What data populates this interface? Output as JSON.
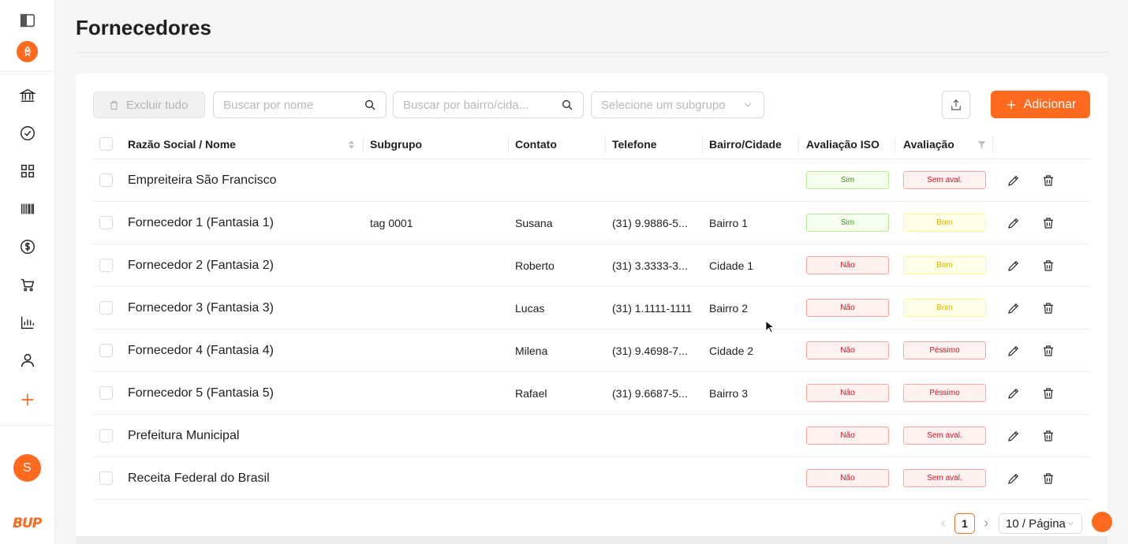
{
  "page": {
    "title": "Fornecedores"
  },
  "sidebar": {
    "items": [
      {
        "icon": "bank-icon"
      },
      {
        "icon": "check-circle-icon"
      },
      {
        "icon": "grid-icon"
      },
      {
        "icon": "barcode-icon"
      },
      {
        "icon": "dollar-icon"
      },
      {
        "icon": "cart-icon"
      },
      {
        "icon": "bar-chart-icon"
      },
      {
        "icon": "user-icon"
      },
      {
        "icon": "plus-icon"
      }
    ],
    "avatar_letter": "S",
    "brand": "BUP"
  },
  "toolbar": {
    "delete_all_label": "Excluir tudo",
    "search_name_placeholder": "Buscar por nome",
    "search_district_placeholder": "Buscar por bairro/cida...",
    "subgroup_placeholder": "Selecione um subgrupo",
    "add_label": "Adicionar"
  },
  "table": {
    "columns": [
      "Razão Social / Nome",
      "Subgrupo",
      "Contato",
      "Telefone",
      "Bairro/Cidade",
      "Avaliação ISO",
      "Avaliação"
    ],
    "rows": [
      {
        "name": "Empreiteira São Francisco",
        "subgroup": "",
        "contact": "",
        "phone": "",
        "district": "",
        "iso": "Sim",
        "rating": "Sem aval."
      },
      {
        "name": "Fornecedor 1 (Fantasia 1)",
        "subgroup": "tag 0001",
        "contact": "Susana",
        "phone": "(31) 9.9886-5...",
        "district": "Bairro 1",
        "iso": "Sim",
        "rating": "Bom"
      },
      {
        "name": "Fornecedor 2 (Fantasia 2)",
        "subgroup": "",
        "contact": "Roberto",
        "phone": "(31) 3.3333-3...",
        "district": "Cidade 1",
        "iso": "Não",
        "rating": "Bom"
      },
      {
        "name": "Fornecedor 3 (Fantasia 3)",
        "subgroup": "",
        "contact": "Lucas",
        "phone": "(31) 1.1111-1111",
        "district": "Bairro 2",
        "iso": "Não",
        "rating": "Bom"
      },
      {
        "name": "Fornecedor 4 (Fantasia 4)",
        "subgroup": "",
        "contact": "Milena",
        "phone": "(31) 9.4698-7...",
        "district": "Cidade 2",
        "iso": "Não",
        "rating": "Péssimo"
      },
      {
        "name": "Fornecedor 5 (Fantasia 5)",
        "subgroup": "",
        "contact": "Rafael",
        "phone": "(31) 9.6687-5...",
        "district": "Bairro 3",
        "iso": "Não",
        "rating": "Péssimo"
      },
      {
        "name": "Prefeitura Municipal",
        "subgroup": "",
        "contact": "",
        "phone": "",
        "district": "",
        "iso": "Não",
        "rating": "Sem aval."
      },
      {
        "name": "Receita Federal do Brasil",
        "subgroup": "",
        "contact": "",
        "phone": "",
        "district": "",
        "iso": "Não",
        "rating": "Sem aval."
      }
    ]
  },
  "pagination": {
    "current_page": "1",
    "page_size": "10 / Página"
  },
  "colors": {
    "accent": "#ff6a1f",
    "tag_green_bg": "#f6ffed",
    "tag_green_border": "#b7eb8f",
    "tag_green_text": "#389e0d",
    "tag_red_bg": "#fff1f0",
    "tag_red_border": "#ffa39e",
    "tag_red_text": "#cf1322",
    "tag_yellow_bg": "#feffe6",
    "tag_yellow_border": "#fffb8f",
    "tag_yellow_text": "#d4b106"
  }
}
